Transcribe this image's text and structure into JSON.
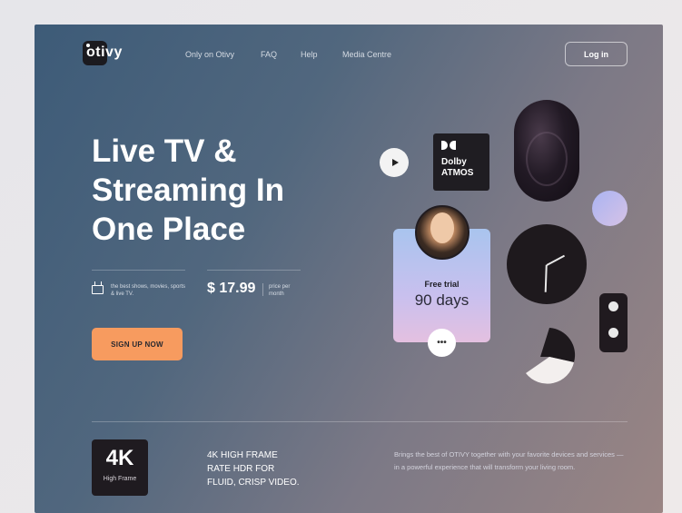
{
  "brand": {
    "name": "otivy"
  },
  "nav": {
    "links": [
      "Only on Otivy",
      "FAQ",
      "Help",
      "Media Centre"
    ],
    "login_label": "Log in"
  },
  "hero": {
    "title_lines": [
      "Live TV &",
      "Streaming In",
      "One Place"
    ],
    "feature_note": "the best shows, movies, sports & live TV.",
    "price": "$ 17.99",
    "price_note": "price per month",
    "cta_label": "SIGN UP NOW"
  },
  "cards": {
    "dolby_line1": "Dolby",
    "dolby_line2": "ATMOS",
    "trial_title": "Free trial",
    "trial_days": "90 days",
    "more_symbol": "•••"
  },
  "bottom": {
    "badge_big": "4K",
    "badge_sub": "High Frame",
    "feature_lines": [
      "4K HIGH FRAME",
      "RATE HDR FOR",
      "FLUID, CRISP VIDEO."
    ],
    "description": "Brings the best of OTIVY together with your favorite devices and services — in a powerful experience that will transform your living room."
  },
  "colors": {
    "accent": "#f79b5f",
    "dark": "#1f1b20",
    "frame_start": "#3d5b78",
    "frame_end": "#9a8584"
  },
  "icons": [
    "play-icon",
    "dolby-icon",
    "tv-icon",
    "remote-illustration",
    "clock-illustration",
    "pie-illustration"
  ]
}
